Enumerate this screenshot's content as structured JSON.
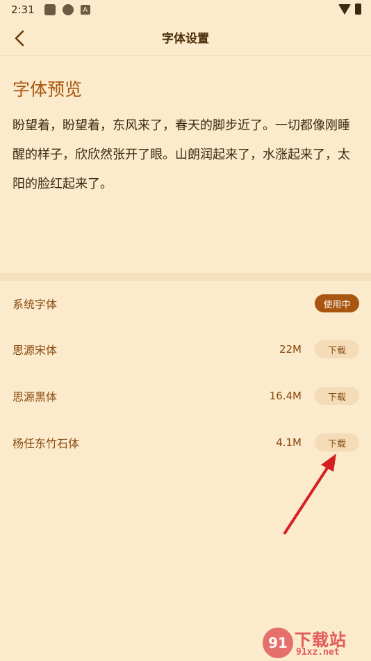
{
  "status_bar": {
    "time": "2:31",
    "notif_letter": "A"
  },
  "header": {
    "title": "字体设置"
  },
  "preview": {
    "title": "字体预览",
    "text": "盼望着，盼望着，东风来了，春天的脚步近了。一切都像刚睡醒的样子，欣欣然张开了眼。山朗润起来了，水涨起来了，太阳的脸红起来了。"
  },
  "fonts": [
    {
      "name": "系统字体",
      "size": "",
      "action": "使用中"
    },
    {
      "name": "思源宋体",
      "size": "22M",
      "action": "下载"
    },
    {
      "name": "思源黑体",
      "size": "16.4M",
      "action": "下载"
    },
    {
      "name": "杨任东竹石体",
      "size": "4.1M",
      "action": "下载"
    }
  ],
  "watermark": {
    "logo": "91",
    "text": "下载站",
    "url": "91xz.net"
  },
  "colors": {
    "background": "#fbeacb",
    "accent": "#a8560f",
    "arrow": "#d42020"
  }
}
